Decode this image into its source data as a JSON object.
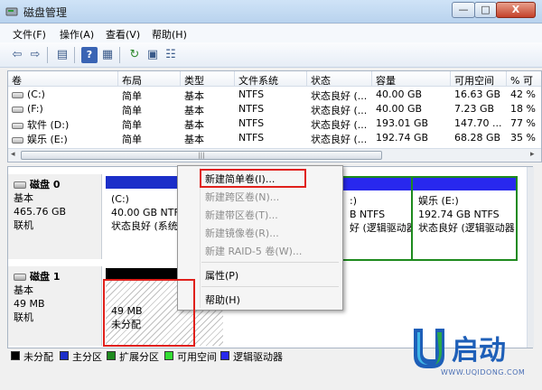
{
  "window": {
    "title": "磁盘管理",
    "min_glyph": "—",
    "max_glyph": "□",
    "close_glyph": "X"
  },
  "menu": [
    "文件(F)",
    "操作(A)",
    "查看(V)",
    "帮助(H)"
  ],
  "toolbar_icons": [
    "back-icon",
    "forward-icon",
    "show-hide-tree-icon",
    "help-icon",
    "properties-icon",
    "refresh-icon",
    "rescan-icon",
    "settings-icon"
  ],
  "volume_list": {
    "columns": [
      "卷",
      "布局",
      "类型",
      "文件系统",
      "状态",
      "容量",
      "可用空间",
      "% 可"
    ],
    "rows": [
      [
        "(C:)",
        "简单",
        "基本",
        "NTFS",
        "状态良好 (...",
        "40.00 GB",
        "16.63 GB",
        "42 %"
      ],
      [
        "(F:)",
        "简单",
        "基本",
        "NTFS",
        "状态良好 (...",
        "40.00 GB",
        "7.23 GB",
        "18 %"
      ],
      [
        "软件 (D:)",
        "简单",
        "基本",
        "NTFS",
        "状态良好 (...",
        "193.01 GB",
        "147.70 ...",
        "77 %"
      ],
      [
        "娱乐 (E:)",
        "简单",
        "基本",
        "NTFS",
        "状态良好 (...",
        "192.74 GB",
        "68.28 GB",
        "35 %"
      ]
    ],
    "scroll_grip": "|||"
  },
  "disks": [
    {
      "name": "磁盘 0",
      "type": "基本",
      "size": "465.76 GB",
      "status": "联机",
      "partitions": [
        {
          "label": "(C:)",
          "detail": "40.00 GB NTFS",
          "status": "状态良好 (系统"
        },
        {
          "label": ":)",
          "detail": "B NTFS",
          "status": "好 (逻辑驱动器"
        },
        {
          "label": "娱乐  (E:)",
          "detail": "192.74 GB NTFS",
          "status": "状态良好 (逻辑驱动器"
        }
      ]
    },
    {
      "name": "磁盘 1",
      "type": "基本",
      "size": "49 MB",
      "status": "联机",
      "partitions": [
        {
          "label": "49 MB",
          "status": "未分配"
        }
      ]
    }
  ],
  "legend": [
    {
      "label": "未分配",
      "color": "#000000"
    },
    {
      "label": "主分区",
      "color": "#1c2fc9"
    },
    {
      "label": "扩展分区",
      "color": "#1e8a1e"
    },
    {
      "label": "可用空间",
      "color": "#33dd33"
    },
    {
      "label": "逻辑驱动器",
      "color": "#2828ee"
    }
  ],
  "context_menu": {
    "items": [
      {
        "label": "新建简单卷(I)...",
        "enabled": true
      },
      {
        "label": "新建跨区卷(N)...",
        "enabled": false
      },
      {
        "label": "新建带区卷(T)...",
        "enabled": false
      },
      {
        "label": "新建镜像卷(R)...",
        "enabled": false
      },
      {
        "label": "新建 RAID-5 卷(W)...",
        "enabled": false
      },
      {
        "label": "属性(P)",
        "enabled": true
      },
      {
        "label": "帮助(H)",
        "enabled": true
      }
    ]
  },
  "watermark": {
    "brand_glyph": "启动",
    "site": "WWW.UQIDONG.COM",
    "colors": [
      "#1e5fb8",
      "#3fb6e6",
      "#2aa84a"
    ]
  }
}
